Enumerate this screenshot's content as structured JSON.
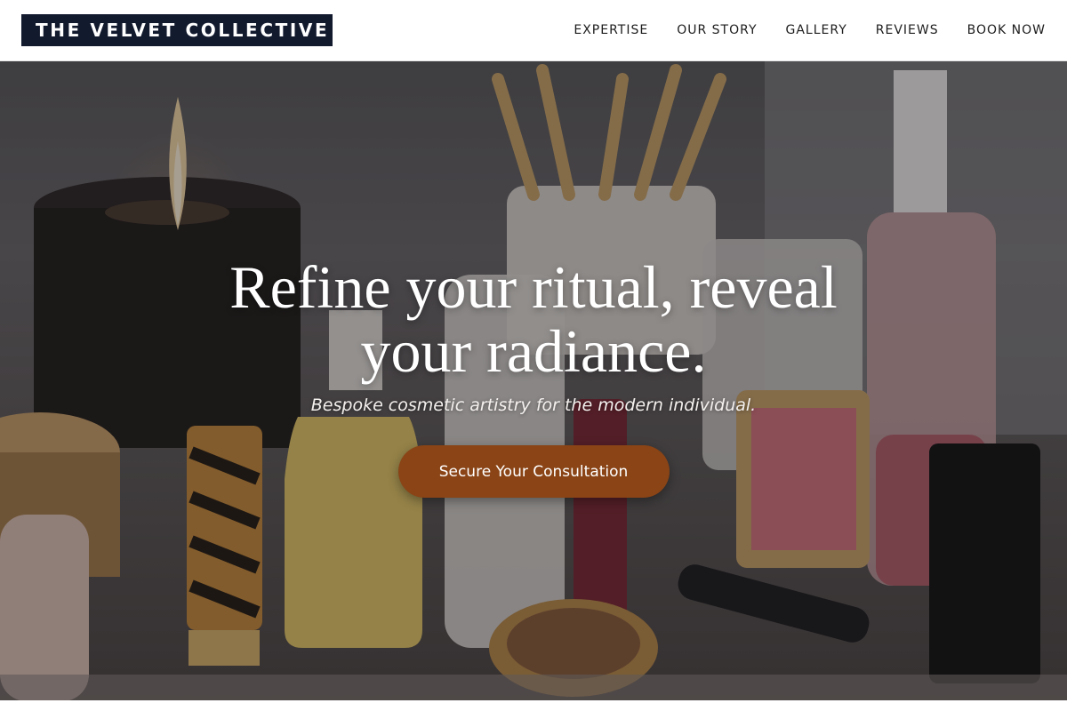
{
  "brand": {
    "name": "THE VELVET COLLECTIVE"
  },
  "nav": {
    "items": [
      {
        "label": "EXPERTISE"
      },
      {
        "label": "OUR STORY"
      },
      {
        "label": "GALLERY"
      },
      {
        "label": "REVIEWS"
      },
      {
        "label": "BOOK NOW"
      }
    ]
  },
  "hero": {
    "title": "Refine your ritual, reveal your radiance.",
    "subtitle": "Bespoke cosmetic artistry for the modern individual.",
    "cta_label": "Secure Your Consultation",
    "background_image": "cosmetics-vanity-photo"
  },
  "colors": {
    "logo_background": "#121a2e",
    "cta_background": "#8a4416",
    "header_background": "#ffffff",
    "nav_text": "#1d1d1d"
  }
}
